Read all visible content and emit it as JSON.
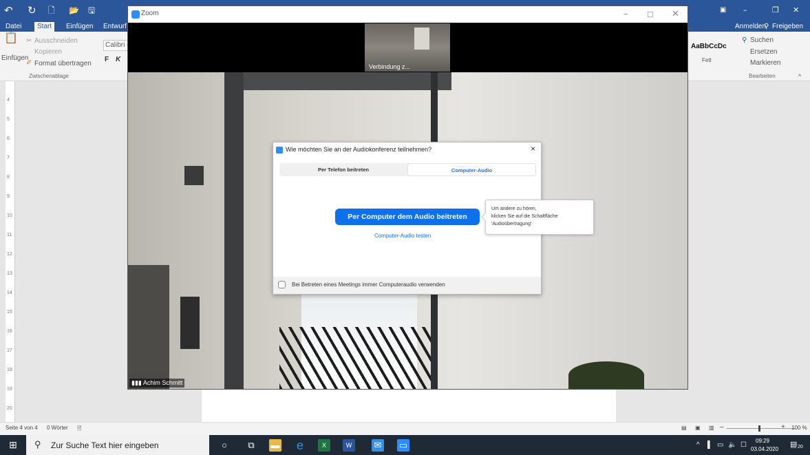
{
  "word": {
    "qat": [
      "↶",
      "↻",
      "🗋",
      "📂",
      "🖫"
    ],
    "tabs": [
      "Datei",
      "Start",
      "Einfügen",
      "Entwurf"
    ],
    "right_top": {
      "anmelden": "Anmelden",
      "freigeben": "Freigeben"
    },
    "clipboard": {
      "paste": "Einfügen",
      "cut": "Ausschneiden",
      "copy": "Kopieren",
      "format": "Format übertragen",
      "group": "Zwischenablage"
    },
    "font_box": "Calibri (",
    "bold": "F",
    "italic": "K",
    "style_preview": "AaBbCcDc",
    "style_name": "Fett",
    "editing": {
      "search": "Suchen",
      "replace": "Ersetzen",
      "select": "Markieren",
      "group": "Bearbeiten"
    },
    "ruler_numbers": [
      "4",
      "5",
      "6",
      "7",
      "8",
      "9",
      "10",
      "11",
      "12",
      "13",
      "14",
      "15",
      "16",
      "17",
      "18",
      "19",
      "20"
    ],
    "status": {
      "page": "Seite 4 von 4",
      "words": "0 Wörter",
      "zoom": "100 %"
    }
  },
  "zoom": {
    "title": "Zoom",
    "thumb_label": "Verbindung z...",
    "participant_name": "Achim Schmitt",
    "dialog": {
      "title": "Wie möchten Sie an der Audiokonferenz teilnehmen?",
      "tab_phone": "Per Telefon beitreten",
      "tab_computer": "Computer-Audio",
      "join_button": "Per Computer dem Audio beitreten",
      "test_link": "Computer-Audio testen",
      "checkbox_label": "Bei Betreten eines Meetings immer Computeraudio verwenden",
      "close": "×"
    },
    "tooltip": [
      "Um andere zu hören,",
      "klicken Sie auf die Schaltfläche",
      "'Audioübertragung'"
    ]
  },
  "taskbar": {
    "search_placeholder": "Zur Suche Text hier eingeben",
    "time": "09:29",
    "date": "03.04.2020",
    "notifications": "20"
  },
  "colors": {
    "word_blue": "#2b579a",
    "zoom_blue": "#0e71eb",
    "taskbar": "#1f2a36"
  }
}
